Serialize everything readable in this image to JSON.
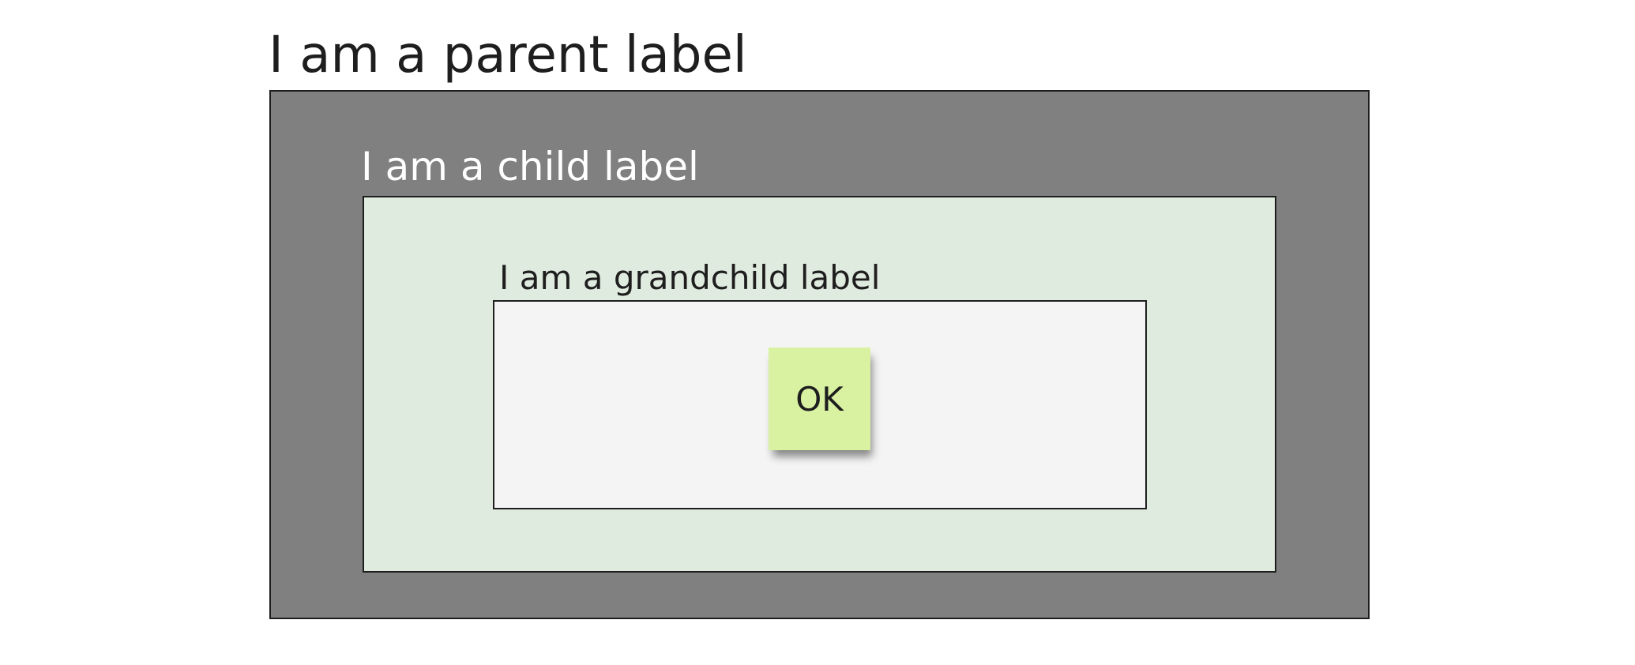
{
  "parent": {
    "label": "I am a parent label",
    "fill_color": "#808080",
    "border_color": "#1e1e1e"
  },
  "child": {
    "label": "I am a child label",
    "fill_color": "#e0ebdf"
  },
  "grandchild": {
    "label": "I am a grandchild label",
    "fill_color": "#f4f4f4"
  },
  "sticky_note": {
    "text": "OK",
    "color": "#d9f2a1"
  }
}
